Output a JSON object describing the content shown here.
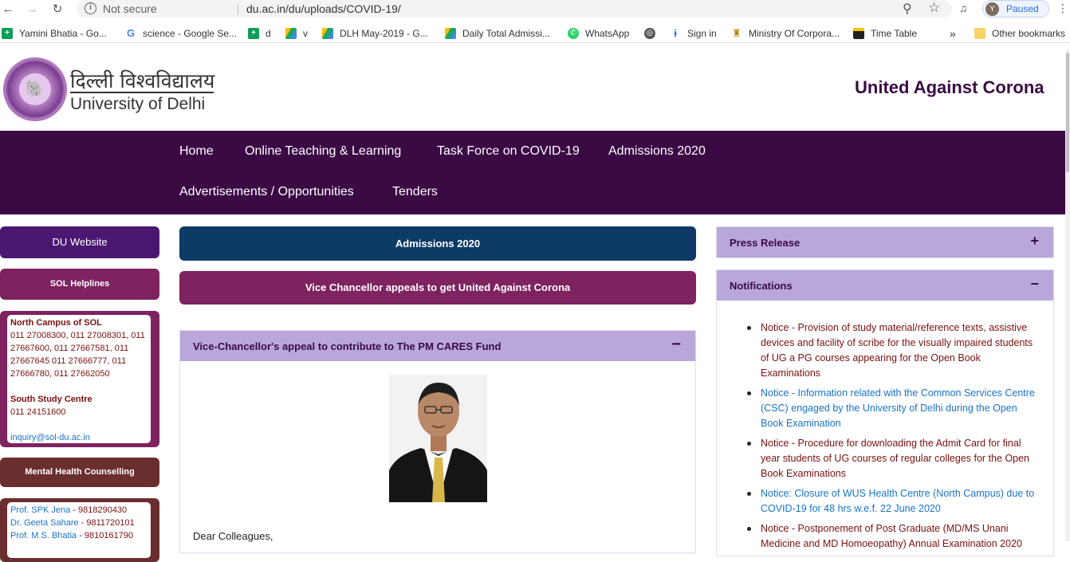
{
  "browser": {
    "security": "Not secure",
    "url": "du.ac.in/du/uploads/COVID-19/",
    "profile_initial": "Y",
    "profile_status": "Paused"
  },
  "bookmarks": [
    {
      "label": "Yamini Bhatia - Go...",
      "icon": "sheets-icon",
      "color": "#0f9d58"
    },
    {
      "label": "science - Google Se...",
      "icon": "google-icon",
      "color": "#4285f4"
    },
    {
      "label": "d",
      "icon": "sheets-icon",
      "color": "#0f9d58"
    },
    {
      "label": "v",
      "icon": "drive-icon",
      "color": "#1fa463"
    },
    {
      "label": "DLH May-2019 - G...",
      "icon": "drive-icon",
      "color": "#1fa463"
    },
    {
      "label": "Daily Total Admissi...",
      "icon": "drive-icon",
      "color": "#1fa463"
    },
    {
      "label": "WhatsApp",
      "icon": "whatsapp-icon",
      "color": "#25d366"
    },
    {
      "label": "",
      "icon": "globe-icon",
      "color": "#555555"
    },
    {
      "label": "Sign in",
      "icon": "signin-icon",
      "color": "#1a73e8"
    },
    {
      "label": "Ministry Of Corpora...",
      "icon": "emblem-icon",
      "color": "#b8860b"
    },
    {
      "label": "Time Table",
      "icon": "timetable-icon",
      "color": "#222222"
    }
  ],
  "bookmarks_overflow": "»",
  "other_bookmarks": "Other bookmarks",
  "site": {
    "hindi_name": "दिल्ली विश्वविद्यालय",
    "english_name": "University of Delhi",
    "tagline": "United Against Corona"
  },
  "nav": [
    "Home",
    "Online Teaching & Learning",
    "Task Force on COVID-19",
    "Admissions 2020",
    "Advertisements / Opportunities",
    "Tenders"
  ],
  "left": {
    "du_website": "DU Website",
    "sol_helplines": "SOL Helplines",
    "sol_box": {
      "north_title": "North Campus of SOL",
      "north_numbers": "011 27008300, 011 27008301, 011 27667600, 011 27667581, 011 27667645 011 27666777, 011 27666780, 011 27662050",
      "south_title": "South Study Centre",
      "south_number": "011 24151600",
      "email": "inquiry@sol-du.ac.in"
    },
    "mental_health": "Mental Health Counselling",
    "counsellors": [
      {
        "name": "Prof. SPK Jena",
        "phone": " - 9818290430"
      },
      {
        "name": "Dr. Geeta Sahare",
        "phone": " - 9811720101"
      },
      {
        "name": "Prof. M.S. Bhatia",
        "phone": " - 9810161790"
      }
    ]
  },
  "center": {
    "admissions": "Admissions 2020",
    "vc_appeal": "Vice Chancellor appeals to get United Against Corona",
    "panel_title": "Vice-Chancellor's appeal to contribute to The PM CARES Fund",
    "panel_toggle": "−",
    "greeting": "Dear Colleagues,"
  },
  "right": {
    "press_release": "Press Release",
    "press_toggle": "+",
    "notifications": "Notifications",
    "notifications_toggle": "−",
    "items": [
      {
        "text": "Notice - Provision of study material/reference texts, assistive devices and facility of scribe for the visually impaired students of UG a PG courses appearing for the Open Book Examinations",
        "style": "red"
      },
      {
        "text": "Notice - Information related with the Common Services Centre (CSC) engaged by the University of Delhi during the Open Book Examination",
        "style": "blue"
      },
      {
        "text": "Notice - Procedure for downloading the Admit Card for final year students of UG courses of regular colleges for the Open Book Examinations",
        "style": "red"
      },
      {
        "text": "Notice: Closure of WUS Health Centre (North Campus) due to COVID-19 for 48 hrs w.e.f. 22 June 2020",
        "style": "blue"
      },
      {
        "text": "Notice - Postponement of Post Graduate (MD/MS Unani Medicine and MD Homoeopathy) Annual Examination 2020",
        "style": "red"
      }
    ]
  },
  "colors": {
    "nav_bg": "#3b0a45",
    "du_website": "#4a1870",
    "sol": "#7e2260",
    "mental_health": "#6a2e2e",
    "admissions_bar": "#0d3b66",
    "vc_bar": "#7e2260",
    "panel_header": "#b9a7d9"
  }
}
